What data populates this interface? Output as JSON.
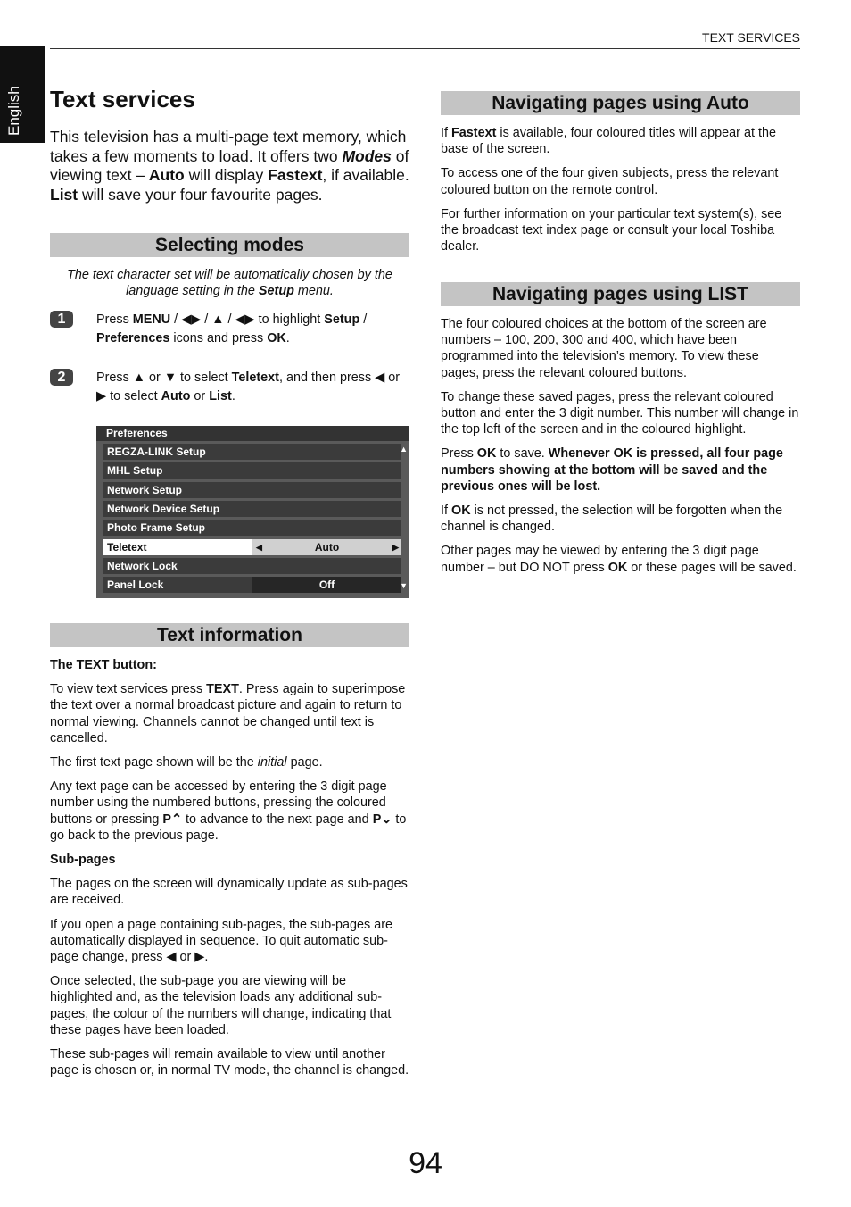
{
  "header": {
    "section": "TEXT SERVICES",
    "language_tab": "English",
    "page_number": "94"
  },
  "title": "Text services",
  "intro": [
    [
      "This television has a multi-page text memory, which takes a few moments to load. It offers two ",
      ""
    ],
    [
      "Modes",
      "bi"
    ],
    [
      " of viewing text – ",
      ""
    ],
    [
      "Auto",
      "b"
    ],
    [
      " will display ",
      ""
    ],
    [
      "Fastext",
      "b"
    ],
    [
      ", if available. ",
      ""
    ],
    [
      "List",
      "b"
    ],
    [
      " will save your four favourite pages.",
      ""
    ]
  ],
  "selecting_modes": {
    "heading": "Selecting modes",
    "note": [
      [
        "The text character set will be automatically chosen by the language setting in the ",
        ""
      ],
      [
        "Setup",
        "b"
      ],
      [
        " menu.",
        ""
      ]
    ],
    "steps": [
      {
        "num": "1",
        "text": [
          [
            "Press ",
            ""
          ],
          [
            "MENU",
            "b"
          ],
          [
            " / ◀▶ / ▲ / ◀▶ to highlight ",
            ""
          ],
          [
            "Setup",
            "b"
          ],
          [
            " / ",
            ""
          ],
          [
            "Preferences",
            "b"
          ],
          [
            " icons and press ",
            ""
          ],
          [
            "OK",
            "b"
          ],
          [
            ".",
            ""
          ]
        ]
      },
      {
        "num": "2",
        "text": [
          [
            "Press ▲ or ▼ to select ",
            ""
          ],
          [
            "Teletext",
            "b"
          ],
          [
            ", and then press ◀ or ▶ to select ",
            ""
          ],
          [
            "Auto",
            "b"
          ],
          [
            " or ",
            ""
          ],
          [
            "List",
            "b"
          ],
          [
            ".",
            ""
          ]
        ]
      }
    ]
  },
  "menu": {
    "title": "Preferences",
    "items": [
      {
        "label": "REGZA-LINK Setup",
        "value": ""
      },
      {
        "label": "MHL Setup",
        "value": ""
      },
      {
        "label": "Network Setup",
        "value": ""
      },
      {
        "label": "Network Device Setup",
        "value": ""
      },
      {
        "label": "Photo Frame Setup",
        "value": ""
      },
      {
        "label": "Teletext",
        "value": "Auto",
        "selected": true
      },
      {
        "label": "Network Lock",
        "value": ""
      },
      {
        "label": "Panel Lock",
        "value": "Off"
      }
    ]
  },
  "text_information": {
    "heading": "Text information",
    "paragraphs": [
      [
        [
          "The TEXT button:",
          "b"
        ]
      ],
      [
        [
          "To view text services press ",
          ""
        ],
        [
          "TEXT",
          "b"
        ],
        [
          ". Press again to superimpose the text over a normal broadcast picture and again to return to normal viewing. Channels cannot be changed until text is cancelled.",
          ""
        ]
      ],
      [
        [
          "The first text page shown will be the ",
          ""
        ],
        [
          "initial",
          "i"
        ],
        [
          " page.",
          ""
        ]
      ],
      [
        [
          "Any text page can be accessed by entering the 3 digit page number using the numbered buttons, pressing the coloured buttons or pressing ",
          ""
        ],
        [
          "P⌃",
          "b"
        ],
        [
          " to advance to the next page and ",
          ""
        ],
        [
          "P⌄",
          "b"
        ],
        [
          " to go back to the previous page.",
          ""
        ]
      ],
      [
        [
          "Sub-pages",
          "b"
        ]
      ],
      [
        [
          "The pages on the screen will dynamically update as sub-pages are received.",
          ""
        ]
      ],
      [
        [
          "If you open a page containing sub-pages, the sub-pages are automatically displayed in sequence. To quit automatic sub-page change, press ◀ or ▶.",
          ""
        ]
      ],
      [
        [
          "Once selected, the sub-page you are viewing will be highlighted and, as the television loads any additional sub-pages, the colour of the numbers will change, indicating that these pages have been loaded.",
          ""
        ]
      ],
      [
        [
          "These sub-pages will remain available to view until another page is chosen or, in normal TV mode, the channel is changed.",
          ""
        ]
      ]
    ]
  },
  "nav_auto": {
    "heading": "Navigating pages using Auto",
    "paragraphs": [
      [
        [
          "If ",
          ""
        ],
        [
          "Fastext",
          "b"
        ],
        [
          " is available, four coloured titles will appear at the base of the screen.",
          ""
        ]
      ],
      [
        [
          "To access one of the four given subjects, press the relevant coloured button on the remote control.",
          ""
        ]
      ],
      [
        [
          "For further information on your particular text system(s), see the broadcast text index page or consult your local Toshiba dealer.",
          ""
        ]
      ]
    ]
  },
  "nav_list": {
    "heading": "Navigating pages using LIST",
    "paragraphs": [
      [
        [
          "The four coloured choices at the bottom of the screen are numbers – 100, 200, 300 and 400, which have been programmed into the television’s memory. To view these pages, press the relevant coloured buttons.",
          ""
        ]
      ],
      [
        [
          "To change these saved pages, press the relevant coloured button and enter the 3 digit number. This number will change in the top left of the screen and in the coloured highlight.",
          ""
        ]
      ],
      [
        [
          "Press ",
          ""
        ],
        [
          "OK",
          "b"
        ],
        [
          " to save. ",
          ""
        ],
        [
          "Whenever OK is pressed, all four page numbers showing at the bottom will be saved and the previous ones will be lost.",
          "b"
        ]
      ],
      [
        [
          "If ",
          ""
        ],
        [
          "OK",
          "b"
        ],
        [
          " is not pressed, the selection will be forgotten when the channel is changed.",
          ""
        ]
      ],
      [
        [
          "Other pages may be viewed by entering the 3 digit page number – but DO NOT press ",
          ""
        ],
        [
          "OK",
          "b"
        ],
        [
          " or these pages will be saved.",
          ""
        ]
      ]
    ]
  }
}
